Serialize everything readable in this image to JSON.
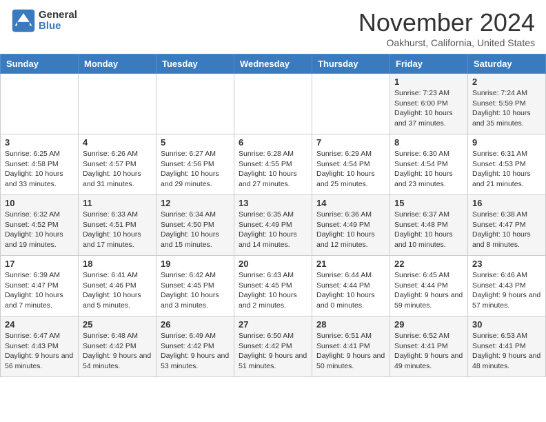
{
  "header": {
    "logo_general": "General",
    "logo_blue": "Blue",
    "month_title": "November 2024",
    "location": "Oakhurst, California, United States"
  },
  "weekdays": [
    "Sunday",
    "Monday",
    "Tuesday",
    "Wednesday",
    "Thursday",
    "Friday",
    "Saturday"
  ],
  "weeks": [
    [
      {
        "day": "",
        "info": ""
      },
      {
        "day": "",
        "info": ""
      },
      {
        "day": "",
        "info": ""
      },
      {
        "day": "",
        "info": ""
      },
      {
        "day": "",
        "info": ""
      },
      {
        "day": "1",
        "info": "Sunrise: 7:23 AM\nSunset: 6:00 PM\nDaylight: 10 hours and 37 minutes."
      },
      {
        "day": "2",
        "info": "Sunrise: 7:24 AM\nSunset: 5:59 PM\nDaylight: 10 hours and 35 minutes."
      }
    ],
    [
      {
        "day": "3",
        "info": "Sunrise: 6:25 AM\nSunset: 4:58 PM\nDaylight: 10 hours and 33 minutes."
      },
      {
        "day": "4",
        "info": "Sunrise: 6:26 AM\nSunset: 4:57 PM\nDaylight: 10 hours and 31 minutes."
      },
      {
        "day": "5",
        "info": "Sunrise: 6:27 AM\nSunset: 4:56 PM\nDaylight: 10 hours and 29 minutes."
      },
      {
        "day": "6",
        "info": "Sunrise: 6:28 AM\nSunset: 4:55 PM\nDaylight: 10 hours and 27 minutes."
      },
      {
        "day": "7",
        "info": "Sunrise: 6:29 AM\nSunset: 4:54 PM\nDaylight: 10 hours and 25 minutes."
      },
      {
        "day": "8",
        "info": "Sunrise: 6:30 AM\nSunset: 4:54 PM\nDaylight: 10 hours and 23 minutes."
      },
      {
        "day": "9",
        "info": "Sunrise: 6:31 AM\nSunset: 4:53 PM\nDaylight: 10 hours and 21 minutes."
      }
    ],
    [
      {
        "day": "10",
        "info": "Sunrise: 6:32 AM\nSunset: 4:52 PM\nDaylight: 10 hours and 19 minutes."
      },
      {
        "day": "11",
        "info": "Sunrise: 6:33 AM\nSunset: 4:51 PM\nDaylight: 10 hours and 17 minutes."
      },
      {
        "day": "12",
        "info": "Sunrise: 6:34 AM\nSunset: 4:50 PM\nDaylight: 10 hours and 15 minutes."
      },
      {
        "day": "13",
        "info": "Sunrise: 6:35 AM\nSunset: 4:49 PM\nDaylight: 10 hours and 14 minutes."
      },
      {
        "day": "14",
        "info": "Sunrise: 6:36 AM\nSunset: 4:49 PM\nDaylight: 10 hours and 12 minutes."
      },
      {
        "day": "15",
        "info": "Sunrise: 6:37 AM\nSunset: 4:48 PM\nDaylight: 10 hours and 10 minutes."
      },
      {
        "day": "16",
        "info": "Sunrise: 6:38 AM\nSunset: 4:47 PM\nDaylight: 10 hours and 8 minutes."
      }
    ],
    [
      {
        "day": "17",
        "info": "Sunrise: 6:39 AM\nSunset: 4:47 PM\nDaylight: 10 hours and 7 minutes."
      },
      {
        "day": "18",
        "info": "Sunrise: 6:41 AM\nSunset: 4:46 PM\nDaylight: 10 hours and 5 minutes."
      },
      {
        "day": "19",
        "info": "Sunrise: 6:42 AM\nSunset: 4:45 PM\nDaylight: 10 hours and 3 minutes."
      },
      {
        "day": "20",
        "info": "Sunrise: 6:43 AM\nSunset: 4:45 PM\nDaylight: 10 hours and 2 minutes."
      },
      {
        "day": "21",
        "info": "Sunrise: 6:44 AM\nSunset: 4:44 PM\nDaylight: 10 hours and 0 minutes."
      },
      {
        "day": "22",
        "info": "Sunrise: 6:45 AM\nSunset: 4:44 PM\nDaylight: 9 hours and 59 minutes."
      },
      {
        "day": "23",
        "info": "Sunrise: 6:46 AM\nSunset: 4:43 PM\nDaylight: 9 hours and 57 minutes."
      }
    ],
    [
      {
        "day": "24",
        "info": "Sunrise: 6:47 AM\nSunset: 4:43 PM\nDaylight: 9 hours and 56 minutes."
      },
      {
        "day": "25",
        "info": "Sunrise: 6:48 AM\nSunset: 4:42 PM\nDaylight: 9 hours and 54 minutes."
      },
      {
        "day": "26",
        "info": "Sunrise: 6:49 AM\nSunset: 4:42 PM\nDaylight: 9 hours and 53 minutes."
      },
      {
        "day": "27",
        "info": "Sunrise: 6:50 AM\nSunset: 4:42 PM\nDaylight: 9 hours and 51 minutes."
      },
      {
        "day": "28",
        "info": "Sunrise: 6:51 AM\nSunset: 4:41 PM\nDaylight: 9 hours and 50 minutes."
      },
      {
        "day": "29",
        "info": "Sunrise: 6:52 AM\nSunset: 4:41 PM\nDaylight: 9 hours and 49 minutes."
      },
      {
        "day": "30",
        "info": "Sunrise: 6:53 AM\nSunset: 4:41 PM\nDaylight: 9 hours and 48 minutes."
      }
    ]
  ]
}
